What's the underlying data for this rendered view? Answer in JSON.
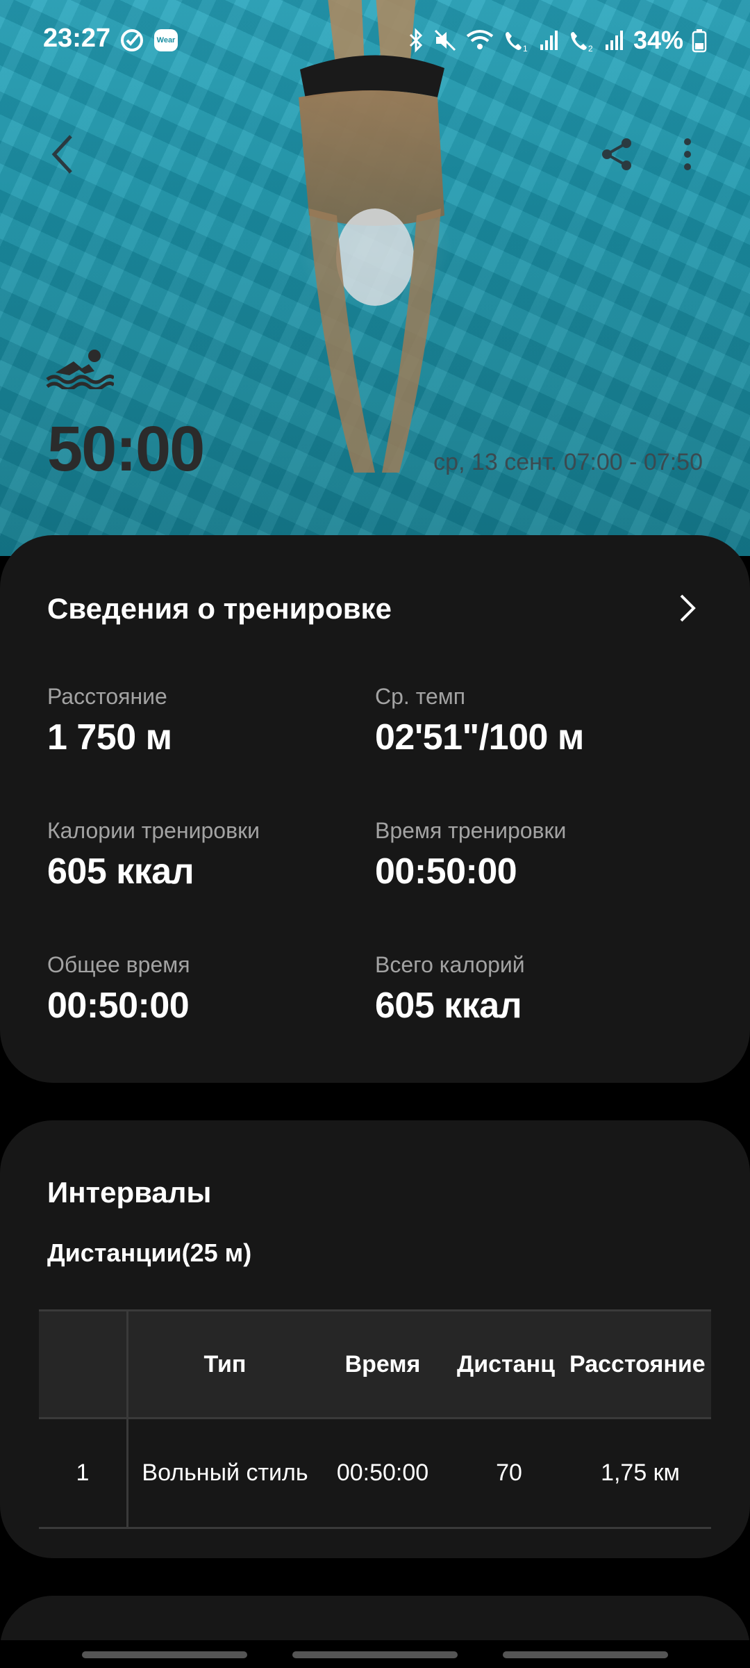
{
  "status_bar": {
    "time": "23:27",
    "wear_badge": "Wear",
    "battery": "34%"
  },
  "header": {
    "activity_icon": "swimming-icon",
    "duration": "50:00",
    "date_range": "ср, 13 сент. 07:00 - 07:50"
  },
  "summary": {
    "title": "Сведения о тренировке",
    "stats": [
      {
        "label": "Расстояние",
        "value": "1 750 м"
      },
      {
        "label": "Ср. темп",
        "value": "02'51\"/100 м"
      },
      {
        "label": "Калории тренировки",
        "value": "605 ккал"
      },
      {
        "label": "Время тренировки",
        "value": "00:50:00"
      },
      {
        "label": "Общее время",
        "value": "00:50:00"
      },
      {
        "label": "Всего калорий",
        "value": "605 ккал"
      }
    ]
  },
  "intervals": {
    "title": "Интервалы",
    "subtitle": "Дистанции(25 м)",
    "columns": [
      "",
      "Тип",
      "Время",
      "Дистанц",
      "Расстояние"
    ],
    "rows": [
      [
        "1",
        "Вольный стиль",
        "00:50:00",
        "70",
        "1,75 км"
      ]
    ]
  },
  "colors": {
    "card_bg": "#171717",
    "pool_water": "#1f98ad",
    "label_gray": "#a3a3a3"
  }
}
